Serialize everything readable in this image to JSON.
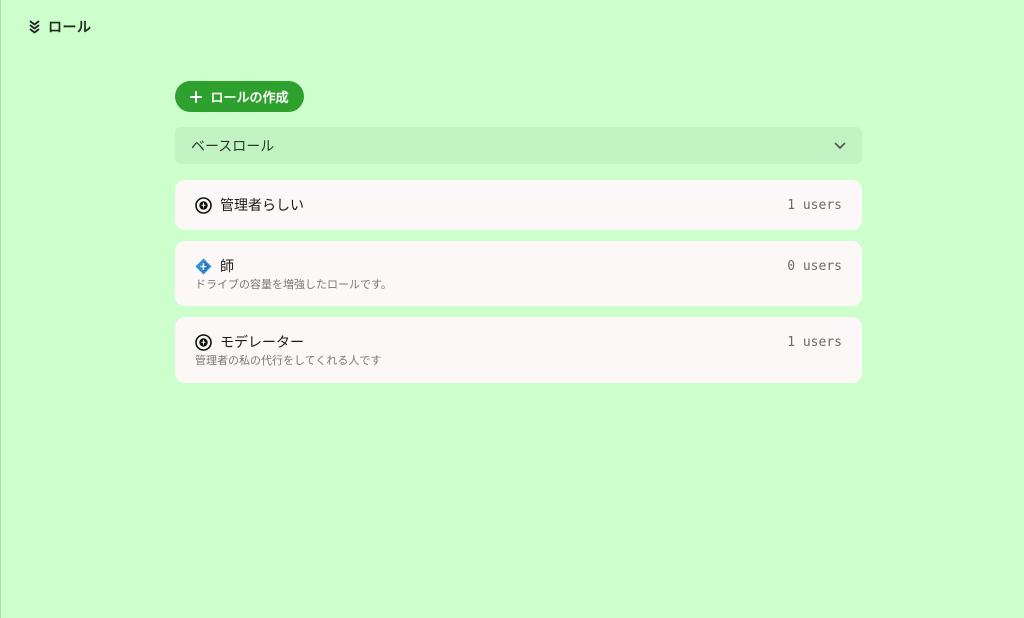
{
  "header": {
    "title": "ロール",
    "icon": "chevrons-down-icon"
  },
  "actions": {
    "create_label": "ロールの作成"
  },
  "base_role": {
    "label": "ベースロール"
  },
  "roles": [
    {
      "name": "管理者らしい",
      "users": "1 users",
      "description": "",
      "icon": "shield-gear-icon"
    },
    {
      "name": "師",
      "users": "0 users",
      "description": "ドライブの容量を増強したロールです。",
      "icon": "blue-diamond-icon"
    },
    {
      "name": "モデレーター",
      "users": "1 users",
      "description": "管理者の私の代行をしてくれる人です",
      "icon": "shield-gear-icon"
    }
  ],
  "colors": {
    "background": "#ccffcc",
    "accent": "#2ea02e",
    "card": "#fdf8f8",
    "base_role_bg": "#c3f2c3"
  }
}
